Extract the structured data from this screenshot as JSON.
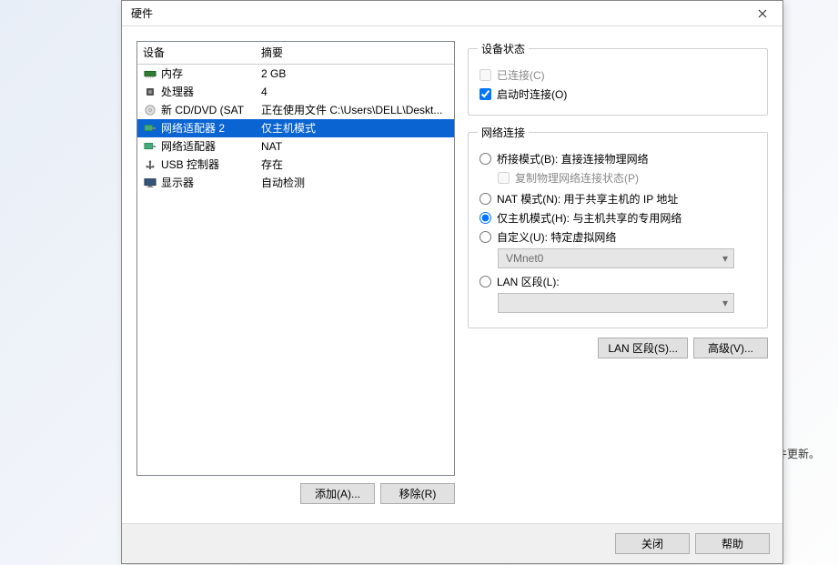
{
  "dialog": {
    "title": "硬件"
  },
  "columns": {
    "device": "设备",
    "summary": "摘要"
  },
  "devices": [
    {
      "icon": "memory",
      "name": "内存",
      "summary": "2 GB"
    },
    {
      "icon": "cpu",
      "name": "处理器",
      "summary": "4"
    },
    {
      "icon": "cd",
      "name": "新 CD/DVD (SAT",
      "summary": "正在使用文件 C:\\Users\\DELL\\Deskt..."
    },
    {
      "icon": "net",
      "name": "网络适配器 2",
      "summary": "仅主机模式",
      "selected": true
    },
    {
      "icon": "net",
      "name": "网络适配器",
      "summary": "NAT"
    },
    {
      "icon": "usb",
      "name": "USB 控制器",
      "summary": "存在"
    },
    {
      "icon": "display",
      "name": "显示器",
      "summary": "自动检测"
    }
  ],
  "left_buttons": {
    "add": "添加(A)...",
    "remove": "移除(R)"
  },
  "status_group": {
    "legend": "设备状态",
    "connected": "已连接(C)",
    "connect_on_power": "启动时连接(O)"
  },
  "net_group": {
    "legend": "网络连接",
    "bridged": "桥接模式(B): 直接连接物理网络",
    "replicate": "复制物理网络连接状态(P)",
    "nat": "NAT 模式(N): 用于共享主机的 IP 地址",
    "hostonly": "仅主机模式(H): 与主机共享的专用网络",
    "custom": "自定义(U): 特定虚拟网络",
    "custom_value": "VMnet0",
    "lan": "LAN 区段(L):",
    "lan_value": ""
  },
  "right_buttons": {
    "lanseg": "LAN 区段(S)...",
    "advanced": "高级(V)..."
  },
  "footer": {
    "close": "关闭",
    "help": "帮助"
  },
  "background_text": "欠件更新。"
}
